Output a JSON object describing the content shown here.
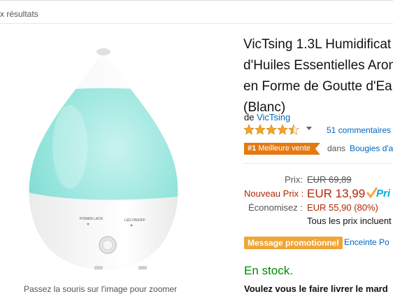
{
  "breadcrumb": "x résultats",
  "product": {
    "title_lines": [
      "VicTsing 1.3L Humidificat",
      "d'Huiles Essentielles Aron",
      "en Forme de Goutte d'Ea",
      "(Blanc)"
    ],
    "by_label": "de",
    "brand": "VicTsing",
    "rating_stars": 4.5,
    "reviews": "51 commentaires",
    "best_seller_rank": "#1",
    "best_seller_label": "Meilleure vente",
    "best_seller_in": "dans",
    "best_seller_category": "Bougies d'a",
    "image_labels": {
      "power": "POWER LACK",
      "led": "LED ON/OFF"
    },
    "zoom_hint": "Passez la souris sur l'image pour zoomer"
  },
  "pricing": {
    "list_label": "Prix:",
    "list_price": "EUR 69,89",
    "new_label": "Nouveau Prix :",
    "new_price": "EUR 13,99",
    "prime_word": "Pri",
    "savings_label": "Économisez :",
    "savings_value": "EUR 55,90 (80%)",
    "all_prices_note": "Tous les prix incluent"
  },
  "promo": {
    "badge": "Message promotionnel",
    "link": "Enceinte Po"
  },
  "stock": "En stock.",
  "delivery": "Voulez vous le faire livrer le mard",
  "colors": {
    "link": "#0066c0",
    "price_red": "#b12704",
    "badge_orange": "#e47911",
    "promo_orange": "#f0a536",
    "stock_green": "#008a00",
    "star": "#f4a41d",
    "prime": "#00a8e1"
  }
}
